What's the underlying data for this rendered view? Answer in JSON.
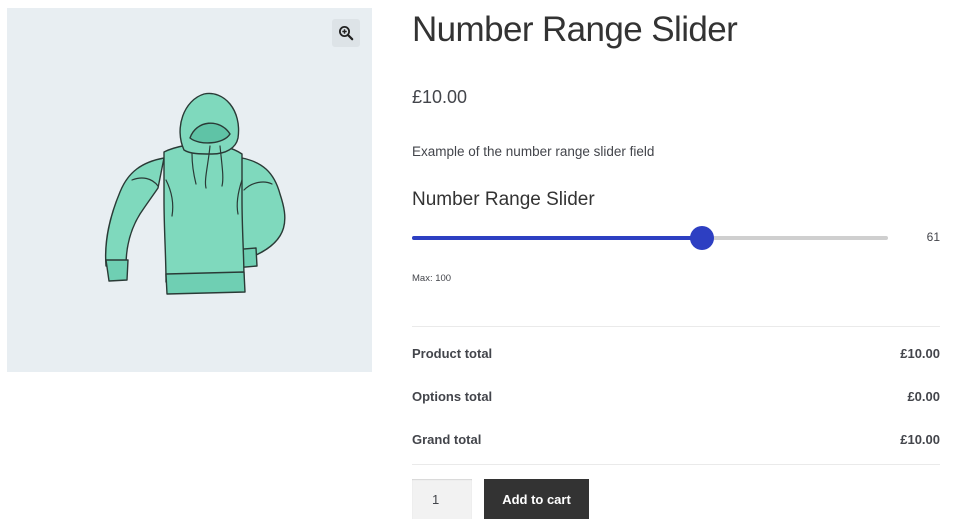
{
  "product": {
    "title": "Number Range Slider",
    "price": "£10.00",
    "description": "Example of the number range slider field"
  },
  "gallery": {
    "zoom_icon": "zoom-in-icon",
    "image": "hoodie-image",
    "background": "#e8eef2"
  },
  "slider_field": {
    "label": "Number Range Slider",
    "value": 61,
    "value_text": "61",
    "min": 0,
    "max": 100,
    "max_text": "Max: 100",
    "accent": "#2d3fc2"
  },
  "totals": {
    "product_total": {
      "label": "Product total",
      "value": "£10.00"
    },
    "options_total": {
      "label": "Options total",
      "value": "£0.00"
    },
    "grand_total": {
      "label": "Grand total",
      "value": "£10.00"
    }
  },
  "cart": {
    "quantity": "1",
    "add_label": "Add to cart"
  }
}
